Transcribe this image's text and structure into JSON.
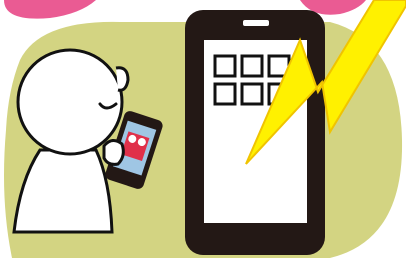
{
  "illustration": {
    "colors": {
      "background": "#ffffff",
      "blob": "#d3d482",
      "pink_arc": "#ea5b93",
      "outline": "#111111",
      "phone_body": "#231815",
      "phone_screen": "#ffffff",
      "lightning_fill": "#fff100",
      "lightning_edge": "#f0c400",
      "small_screen_content": "#e0304a",
      "small_screen_bg": "#9fc6e4"
    },
    "icons": {
      "large_phone": "smartphone-icon",
      "lightning": "lightning-bolt-icon",
      "app_grid": "app-grid-icon",
      "person": "person-icon",
      "small_phone": "smartphone-icon"
    },
    "app_grid": {
      "rows": 2,
      "columns": 3
    }
  }
}
